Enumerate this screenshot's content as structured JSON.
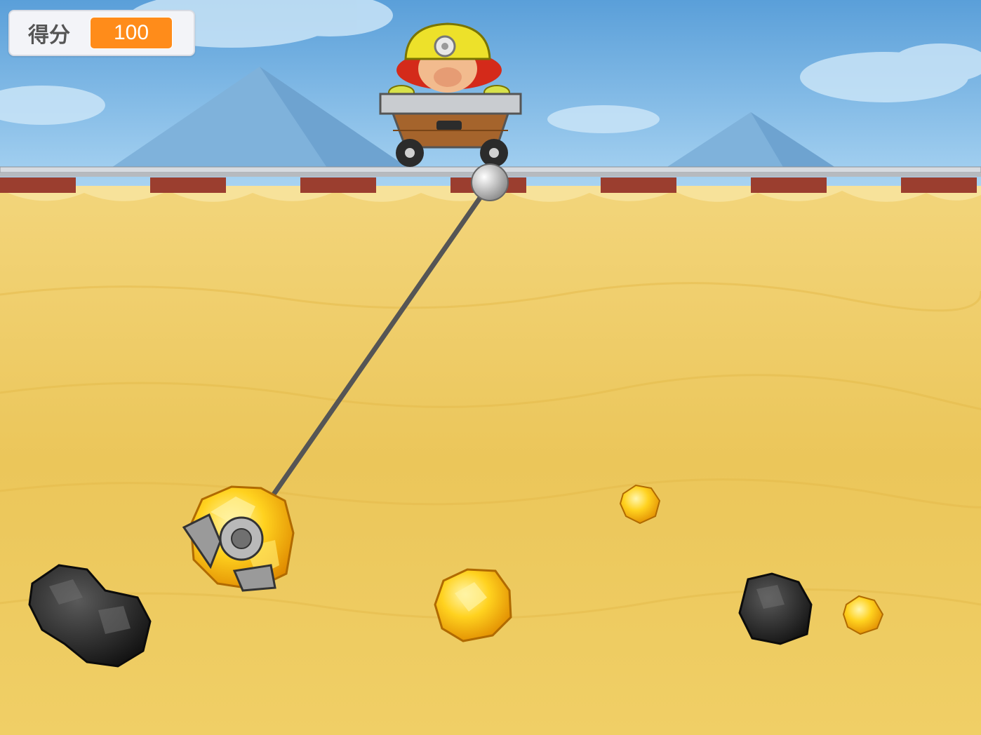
{
  "hud": {
    "score_label": "得分",
    "score_value": "100"
  },
  "colors": {
    "sky": "#8fc3ea",
    "sand": "#efcb5a",
    "score_badge": "#ff8c1a",
    "rope": "#555555"
  },
  "sprites": {
    "miner": "miner-in-cart",
    "hook": "claw-hook",
    "gold": "gold-nugget",
    "stone": "coal-rock"
  }
}
